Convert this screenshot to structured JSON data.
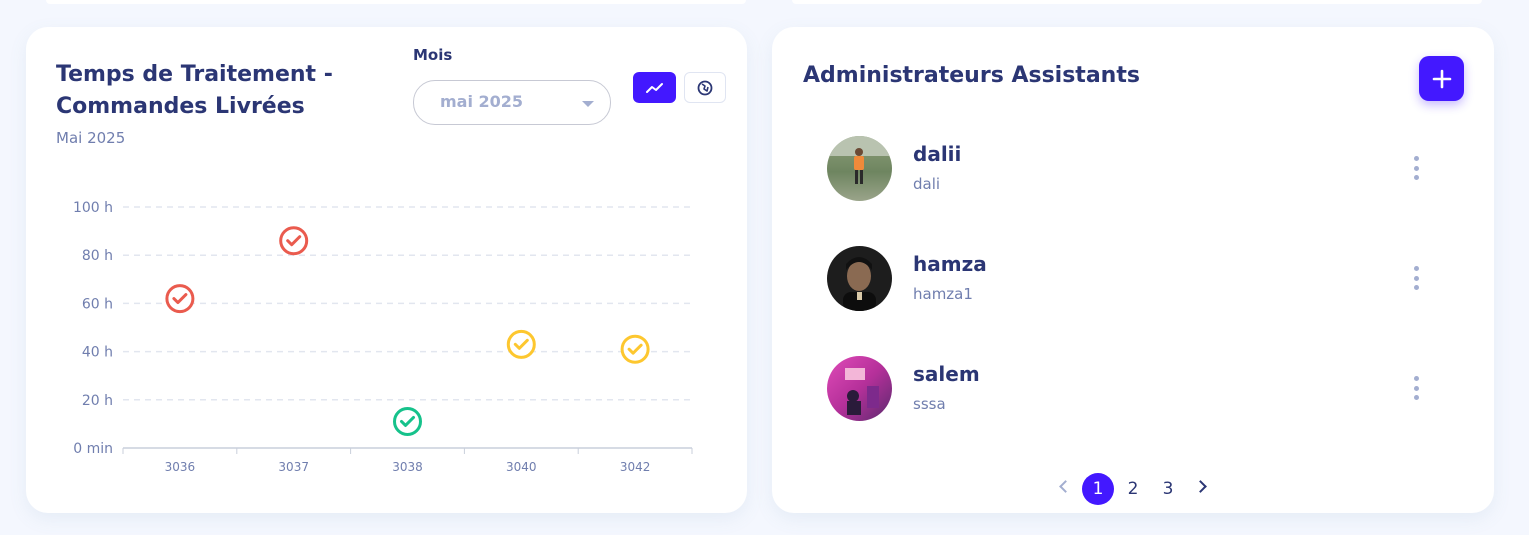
{
  "left_card": {
    "title": "Temps de Traitement - Commandes Livrées",
    "subtitle": "Mai 2025",
    "month_label": "Mois",
    "month_select": {
      "value": "mai 2025"
    },
    "buttons": [
      {
        "icon": "trend-line-icon",
        "active": true
      },
      {
        "icon": "globe-icon",
        "active": false
      }
    ]
  },
  "chart_data": {
    "type": "scatter",
    "categories": [
      "3036",
      "3037",
      "3038",
      "3040",
      "3042"
    ],
    "values": [
      62,
      86,
      11,
      43,
      41
    ],
    "point_colors": [
      "#ea5b4e",
      "#ea5b4e",
      "#16c28b",
      "#fdc72f",
      "#fdc72f"
    ],
    "marker": "check-circle-icon",
    "y_ticks": [
      "0 min",
      "20 h",
      "40 h",
      "60 h",
      "80 h",
      "100 h"
    ],
    "ylim": [
      0,
      100
    ],
    "grid": true,
    "title": "",
    "xlabel": "",
    "ylabel": ""
  },
  "right_card": {
    "title": "Administrateurs Assistants",
    "add_button_icon": "plus-icon",
    "admins": [
      {
        "name": "dalii",
        "username": "dali",
        "avatar_colors": [
          "#7a8c62",
          "#b8c0ae"
        ]
      },
      {
        "name": "hamza",
        "username": "hamza1",
        "avatar_colors": [
          "#1e1e1e",
          "#5a4a3a"
        ]
      },
      {
        "name": "salem",
        "username": "sssa",
        "avatar_colors": [
          "#d23aa6",
          "#6a2c7e"
        ]
      }
    ],
    "pagination": {
      "pages": [
        "1",
        "2",
        "3"
      ],
      "current": "1"
    }
  },
  "colors": {
    "accent": "#4318ff",
    "text_dark": "#2b3674",
    "text_muted": "#707eae",
    "background": "#f4f7fe"
  }
}
